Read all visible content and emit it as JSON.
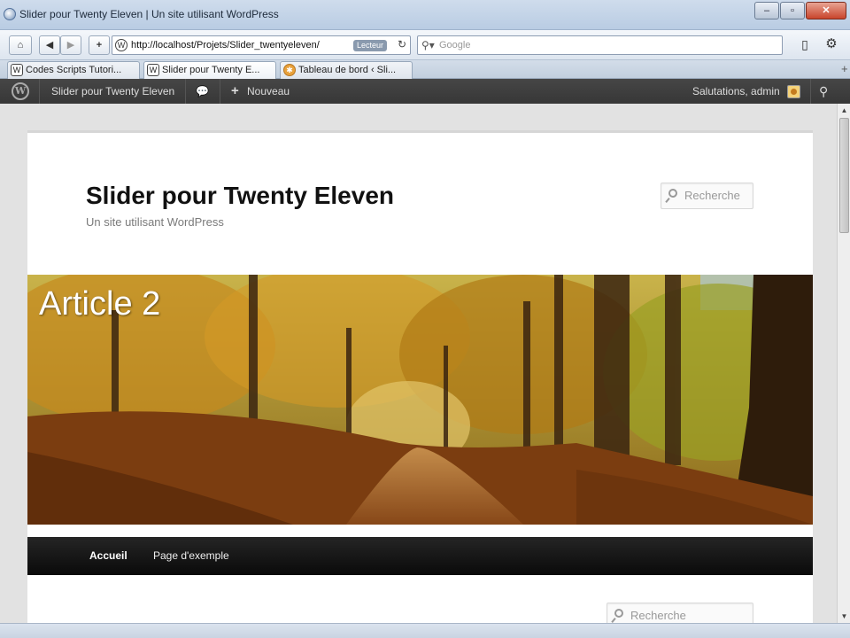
{
  "window": {
    "title": "Slider pour Twenty Eleven | Un site utilisant WordPress",
    "minimize": "–",
    "maximize": "▫",
    "close": "✕"
  },
  "toolbar": {
    "home_icon": "⌂",
    "back_icon": "◀",
    "forward_icon": "▶",
    "add_icon": "+",
    "url": "http://localhost/Projets/Slider_twentyeleven/",
    "reader_label": "Lecteur",
    "reload_icon": "↻",
    "search_placeholder": "Google",
    "page_icon": "▯",
    "tools_icon": "⚙"
  },
  "tabs": [
    {
      "label": "Codes Scripts Tutori..."
    },
    {
      "label": "Slider pour Twenty E..."
    },
    {
      "label": "Tableau de bord ‹ Sli..."
    }
  ],
  "adminbar": {
    "wp_logo": "W",
    "site_name": "Slider pour Twenty Eleven",
    "comments_icon": "💬",
    "new_label": "Nouveau",
    "new_icon": "+",
    "greeting": "Salutations, admin",
    "search_icon": "⚲"
  },
  "site": {
    "title": "Slider pour Twenty Eleven",
    "description": "Un site utilisant WordPress",
    "search_placeholder": "Recherche",
    "hero_title": "Article 2",
    "nav": [
      "Accueil",
      "Page d'exemple"
    ],
    "sidebar_search_placeholder": "Recherche"
  },
  "colors": {
    "adminbar": "#464646",
    "mainnav": "#111111"
  }
}
